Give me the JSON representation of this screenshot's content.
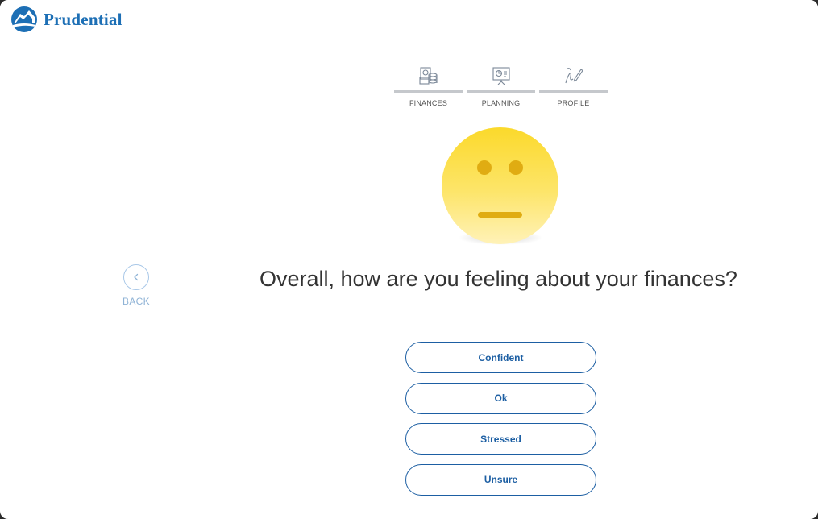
{
  "header": {
    "brand": "Prudential",
    "logo_icon": "rock-of-gibraltar-logo"
  },
  "steps": [
    {
      "label": "FINANCES",
      "icon": "money-stack-icon"
    },
    {
      "label": "PLANNING",
      "icon": "presentation-board-icon"
    },
    {
      "label": "PROFILE",
      "icon": "pen-signature-icon"
    }
  ],
  "mood": {
    "icon": "neutral-face-icon"
  },
  "back": {
    "label": "BACK",
    "icon": "chevron-left-icon"
  },
  "question": "Overall, how are you feeling about your finances?",
  "options": [
    "Confident",
    "Ok",
    "Stressed",
    "Unsure"
  ],
  "colors": {
    "brand_blue": "#1d6fb5",
    "button_blue": "#1d5fa3",
    "face_yellow": "#fbd92b"
  }
}
